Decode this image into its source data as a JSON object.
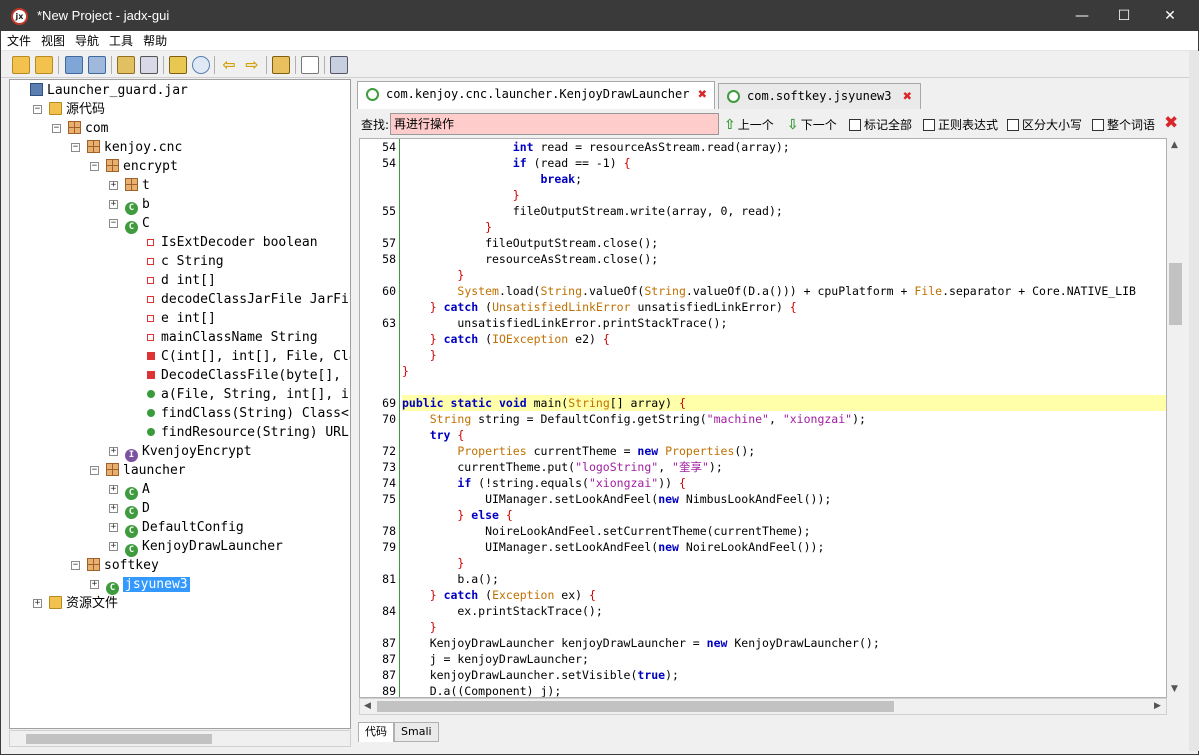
{
  "window": {
    "title": "*New Project - jadx-gui",
    "minimize": "—",
    "maximize": "☐",
    "close": "✕"
  },
  "menu": [
    "文件",
    "视图",
    "导航",
    "工具",
    "帮助"
  ],
  "toolbar": {
    "icons": [
      "open-folder-icon",
      "add-files-icon",
      "save-all-icon",
      "export-icon",
      "sync-icon",
      "expand-tree-icon",
      "wand-icon",
      "search-icon",
      "back-icon",
      "forward-icon",
      "decompile-icon",
      "log-icon",
      "preferences-icon"
    ]
  },
  "tree": {
    "nodes": [
      {
        "label": "Launcher_guard.jar",
        "depth": 0,
        "kind": "jar",
        "exp": ""
      },
      {
        "label": "源代码",
        "depth": 1,
        "kind": "folder",
        "exp": "−"
      },
      {
        "label": "com",
        "depth": 2,
        "kind": "pkg",
        "exp": "−"
      },
      {
        "label": "kenjoy.cnc",
        "depth": 3,
        "kind": "pkg",
        "exp": "−"
      },
      {
        "label": "encrypt",
        "depth": 4,
        "kind": "pkg",
        "exp": "−"
      },
      {
        "label": "t",
        "depth": 5,
        "kind": "pkg",
        "exp": "+"
      },
      {
        "label": "b",
        "depth": 5,
        "kind": "cls",
        "exp": "+"
      },
      {
        "label": "C",
        "depth": 5,
        "kind": "cls",
        "exp": "−"
      },
      {
        "label": "IsExtDecoder boolean",
        "depth": 6,
        "kind": "fld",
        "exp": ""
      },
      {
        "label": "c String",
        "depth": 6,
        "kind": "fld",
        "exp": ""
      },
      {
        "label": "d int[]",
        "depth": 6,
        "kind": "fld",
        "exp": ""
      },
      {
        "label": "decodeClassJarFile JarFile",
        "depth": 6,
        "kind": "fld",
        "exp": ""
      },
      {
        "label": "e int[]",
        "depth": 6,
        "kind": "fld",
        "exp": ""
      },
      {
        "label": "mainClassName String",
        "depth": 6,
        "kind": "fld",
        "exp": ""
      },
      {
        "label": "C(int[], int[], File, Class",
        "depth": 6,
        "kind": "mth",
        "exp": ""
      },
      {
        "label": "DecodeClassFile(byte[], in",
        "depth": 6,
        "kind": "mth",
        "exp": ""
      },
      {
        "label": "a(File, String, int[], int",
        "depth": 6,
        "kind": "mthg",
        "exp": ""
      },
      {
        "label": "findClass(String) Class<?>",
        "depth": 6,
        "kind": "mthg",
        "exp": ""
      },
      {
        "label": "findResource(String) URL",
        "depth": 6,
        "kind": "mthg",
        "exp": ""
      },
      {
        "label": "KvenjoyEncrypt",
        "depth": 5,
        "kind": "itf",
        "exp": "+"
      },
      {
        "label": "launcher",
        "depth": 4,
        "kind": "pkg",
        "exp": "−"
      },
      {
        "label": "A",
        "depth": 5,
        "kind": "cls",
        "exp": "+"
      },
      {
        "label": "D",
        "depth": 5,
        "kind": "cls",
        "exp": "+"
      },
      {
        "label": "DefaultConfig",
        "depth": 5,
        "kind": "cls",
        "exp": "+"
      },
      {
        "label": "KenjoyDrawLauncher",
        "depth": 5,
        "kind": "cls",
        "exp": "+"
      },
      {
        "label": "softkey",
        "depth": 3,
        "kind": "pkg",
        "exp": "−"
      },
      {
        "label": "jsyunew3",
        "depth": 4,
        "kind": "cls",
        "exp": "+",
        "selected": true
      },
      {
        "label": "资源文件",
        "depth": 1,
        "kind": "folder",
        "exp": "+"
      }
    ]
  },
  "tabs": [
    {
      "label": "com.kenjoy.cnc.launcher.KenjoyDrawLauncher",
      "active": true
    },
    {
      "label": "com.softkey.jsyunew3",
      "active": false
    }
  ],
  "find": {
    "label": "查找:",
    "value": "再进行操作",
    "prev": "上一个",
    "next": "下一个",
    "mark_all": "标记全部",
    "regex": "正则表达式",
    "case": "区分大小写",
    "whole_word": "整个词语"
  },
  "code": {
    "lines": [
      {
        "n": "54",
        "t": "                int read = resourceAsStream.read(array);"
      },
      {
        "n": "54",
        "t": "                if (read == -1) {"
      },
      {
        "n": "",
        "t": "                    break;"
      },
      {
        "n": "",
        "t": "                }"
      },
      {
        "n": "55",
        "t": "                fileOutputStream.write(array, 0, read);"
      },
      {
        "n": "",
        "t": "            }"
      },
      {
        "n": "57",
        "t": "            fileOutputStream.close();"
      },
      {
        "n": "58",
        "t": "            resourceAsStream.close();"
      },
      {
        "n": "",
        "t": "        }"
      },
      {
        "n": "60",
        "t": "        System.load(String.valueOf(String.valueOf(D.a())) + cpuPlatform + File.separator + Core.NATIVE_LIB"
      },
      {
        "n": "",
        "t": "    } catch (UnsatisfiedLinkError unsatisfiedLinkError) {"
      },
      {
        "n": "63",
        "t": "        unsatisfiedLinkError.printStackTrace();"
      },
      {
        "n": "",
        "t": "    } catch (IOException e2) {"
      },
      {
        "n": "",
        "t": "    }"
      },
      {
        "n": "",
        "t": "}"
      },
      {
        "n": "",
        "t": ""
      },
      {
        "n": "69",
        "t": "public static void main(String[] array) {",
        "hl": true
      },
      {
        "n": "70",
        "t": "    String string = DefaultConfig.getString(\"machine\", \"xiongzai\");"
      },
      {
        "n": "",
        "t": "    try {"
      },
      {
        "n": "72",
        "t": "        Properties currentTheme = new Properties();"
      },
      {
        "n": "73",
        "t": "        currentTheme.put(\"logoString\", \"奎享\");"
      },
      {
        "n": "74",
        "t": "        if (!string.equals(\"xiongzai\")) {"
      },
      {
        "n": "75",
        "t": "            UIManager.setLookAndFeel(new NimbusLookAndFeel());"
      },
      {
        "n": "",
        "t": "        } else {"
      },
      {
        "n": "78",
        "t": "            NoireLookAndFeel.setCurrentTheme(currentTheme);"
      },
      {
        "n": "79",
        "t": "            UIManager.setLookAndFeel(new NoireLookAndFeel());"
      },
      {
        "n": "",
        "t": "        }"
      },
      {
        "n": "81",
        "t": "        b.a();"
      },
      {
        "n": "",
        "t": "    } catch (Exception ex) {"
      },
      {
        "n": "84",
        "t": "        ex.printStackTrace();"
      },
      {
        "n": "",
        "t": "    }"
      },
      {
        "n": "87",
        "t": "    KenjoyDrawLauncher kenjoyDrawLauncher = new KenjoyDrawLauncher();"
      },
      {
        "n": "87",
        "t": "    j = kenjoyDrawLauncher;"
      },
      {
        "n": "87",
        "t": "    kenjoyDrawLauncher.setVisible(true);"
      },
      {
        "n": "89",
        "t": "    D.a((Component) j);"
      }
    ]
  },
  "bottom_tabs": [
    "代码",
    "Smali"
  ],
  "colors": {
    "titlebar": "#3a3a3a",
    "keyword": "#0000c0",
    "type": "#c07000",
    "string": "#a01fa0",
    "highlight": "#ffffaa",
    "find_bg": "#ffcccc",
    "selection": "#3399ff"
  }
}
